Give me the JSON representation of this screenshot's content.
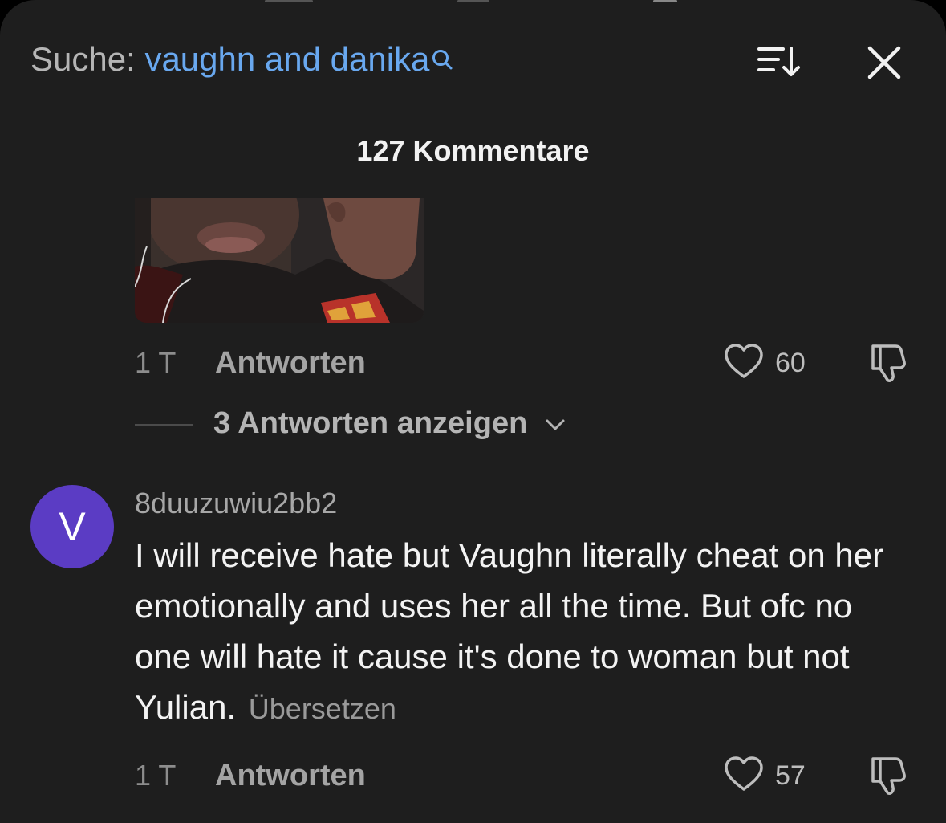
{
  "search": {
    "prefix": "Suche:",
    "query": "vaughn and danika",
    "icon": "search-icon"
  },
  "header": {
    "sort_icon": "sort-icon",
    "close_icon": "close-icon",
    "comments_count": "127 Kommentare"
  },
  "comments": [
    {
      "time": "1 T",
      "reply_label": "Antworten",
      "likes": "60",
      "replies_toggle": "3 Antworten anzeigen",
      "has_image": true
    },
    {
      "avatar_letter": "V",
      "avatar_color": "#5b3cc4",
      "username": "8duuzuwiu2bb2",
      "text": "I will receive hate but Vaughn literally cheat on her emotionally and uses her all the time. But ofc no one will hate it cause it's done to woman but not Yulian.",
      "translate_label": "Übersetzen",
      "time": "1 T",
      "reply_label": "Antworten",
      "likes": "57"
    }
  ],
  "colors": {
    "background": "#1e1e1e",
    "query": "#69a8ef",
    "muted": "#a4a4a4"
  }
}
